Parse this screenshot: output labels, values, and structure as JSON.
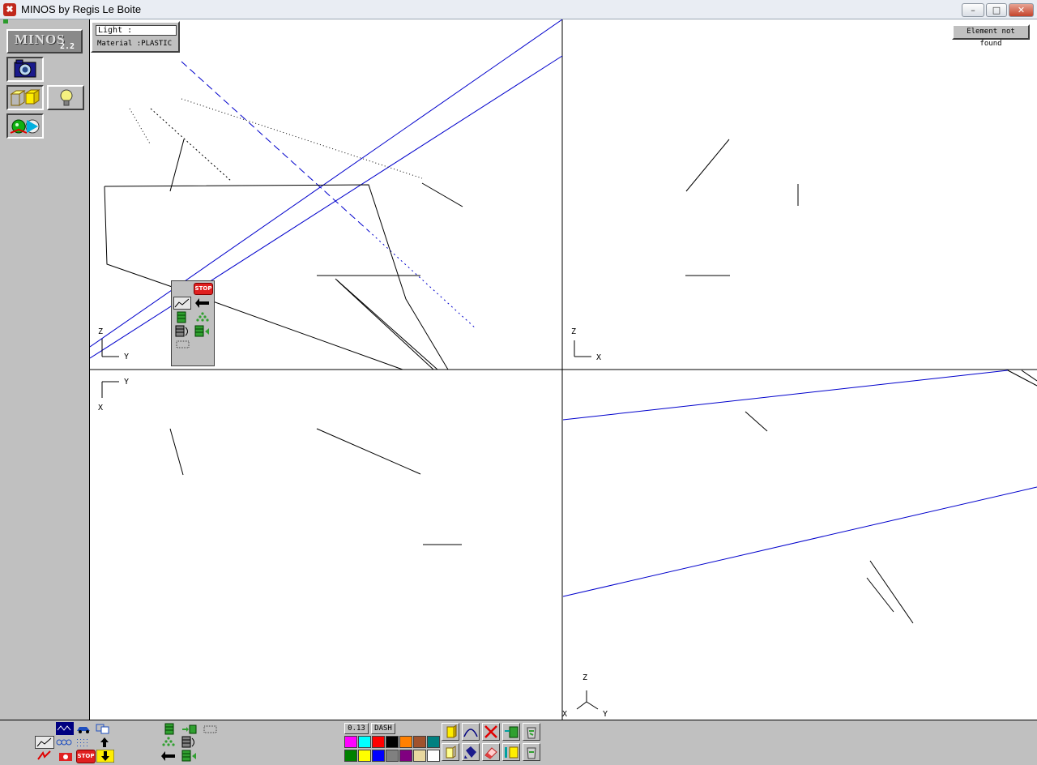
{
  "window": {
    "title": "MINOS by Regis Le Boite",
    "app_icon_glyph": "✖",
    "minimize_glyph": "–",
    "maximize_glyph": "□",
    "close_glyph": "✕"
  },
  "logo": {
    "name": "MINOS",
    "version": "2.2"
  },
  "info": {
    "light": "Light    :",
    "material": "Material :PLASTIC"
  },
  "status": {
    "message": "Element not found"
  },
  "palette": {
    "stop_label": "STOP"
  },
  "viewports": {
    "top_left": {
      "axis_vertical": "Z",
      "axis_horizontal": "Y"
    },
    "top_right": {
      "axis_vertical": "Z",
      "axis_horizontal": "X"
    },
    "bottom_left": {
      "axis_vertical": "X",
      "axis_horizontal": "Y"
    },
    "bottom_right": {
      "axis_up": "Z",
      "axis_left": "X",
      "axis_right": "Y"
    }
  },
  "bottom": {
    "line_width": "0.13",
    "line_style": "DASH",
    "stop_label": "STOP",
    "colors": [
      "#ff00ff",
      "#00ffff",
      "#ff0000",
      "#000000",
      "#ff8000",
      "#a0522d",
      "#008080",
      "#008000",
      "#ffff00",
      "#0000ff",
      "#808080",
      "#800080",
      "#e8d8a0",
      "#ffffff"
    ]
  },
  "colors": {
    "line_blue": "#0000cc",
    "line_black": "#000000"
  }
}
